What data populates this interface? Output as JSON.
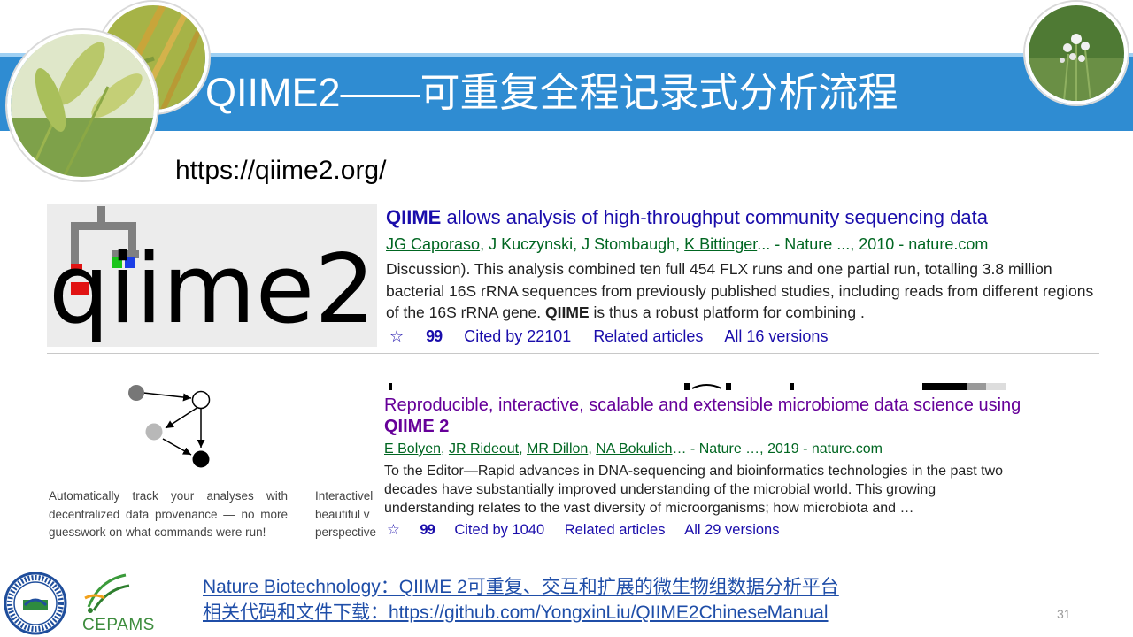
{
  "slide": {
    "title": "QIIME2——可重复全程记录式分析流程",
    "url": "https://qiime2.org/",
    "page_number": "31"
  },
  "result1": {
    "title_bold": "QIIME",
    "title_rest": " allows analysis of high-throughput community sequencing data",
    "author1": "JG Caporaso",
    "authors_mid": ", J Kuczynski, J Stombaugh, ",
    "author2": "K Bittinger",
    "source": "... - Nature ..., 2010 - nature.com",
    "snippet_a": "Discussion). This analysis combined ten full 454 FLX runs and one partial run, totalling 3.8 million bacterial 16S rRNA sequences from previously published studies, including reads from different regions of the 16S rRNA gene. ",
    "snippet_bold": "QIIME",
    "snippet_b": " is thus a robust platform for combining .",
    "star": "☆",
    "quote": "99",
    "cited": "Cited by 22101",
    "related": "Related articles",
    "versions": "All 16 versions"
  },
  "result2": {
    "title": "Reproducible, interactive, scalable and extensible microbiome data science using",
    "title_bold": "QIIME 2",
    "authors": [
      "E Bolyen",
      "JR Rideout",
      "MR Dillon",
      "NA Bokulich"
    ],
    "source": "… - Nature …, 2019 - nature.com",
    "snippet": "To the Editor—Rapid advances in DNA-sequencing and bioinformatics technologies in the past two decades have substantially improved understanding of the microbial world. This growing understanding relates to the vast diversity of microorganisms; how microbiota and …",
    "star": "☆",
    "quote": "99",
    "cited": "Cited by 1040",
    "related": "Related articles",
    "versions": "All 29 versions"
  },
  "features": {
    "provenance": "Automatically track your analyses with decentralized data provenance — no more guesswork on what commands were run!",
    "interactive": "Interactivel beautiful v perspective"
  },
  "footer": {
    "link1": "Nature Biotechnology：QIIME 2可重复、交互和扩展的微生物组数据分析平台",
    "link2": "相关代码和文件下载：https://github.com/YongxinLiu/QIIME2ChineseManual",
    "logo_text": "CEPAMS"
  },
  "logo": {
    "text": "qiime2"
  },
  "colors": {
    "title_bar": "#2f8cd2",
    "link_blue": "#1a0dab",
    "author_green": "#006621",
    "visited_purple": "#660099"
  }
}
